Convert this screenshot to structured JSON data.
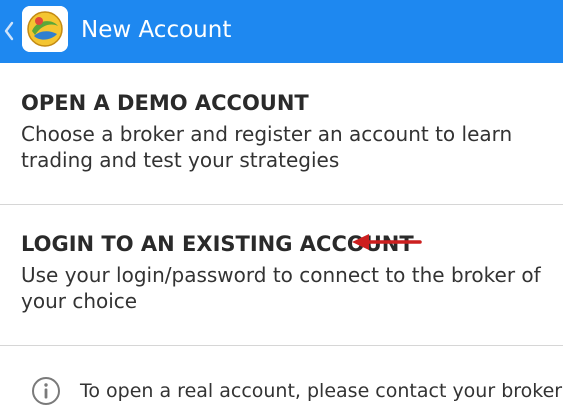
{
  "appbar": {
    "title": "New Account",
    "icons": {
      "back": "chevron-left-icon",
      "logo": "metatrader-logo-icon"
    },
    "colors": {
      "background": "#1e88f0",
      "text": "#ffffff"
    }
  },
  "options": [
    {
      "title": "OPEN A DEMO ACCOUNT",
      "description": "Choose a broker and register an account to learn trading and test your strategies"
    },
    {
      "title": "LOGIN TO AN EXISTING ACCOUNT",
      "description": "Use your login/password to connect to the broker of your choice",
      "annotation": {
        "icon": "red-arrow-left-icon",
        "color": "#cc1f1f"
      }
    }
  ],
  "info": {
    "icon": "info-circle-icon",
    "text": "To open a real account, please contact your broker"
  }
}
